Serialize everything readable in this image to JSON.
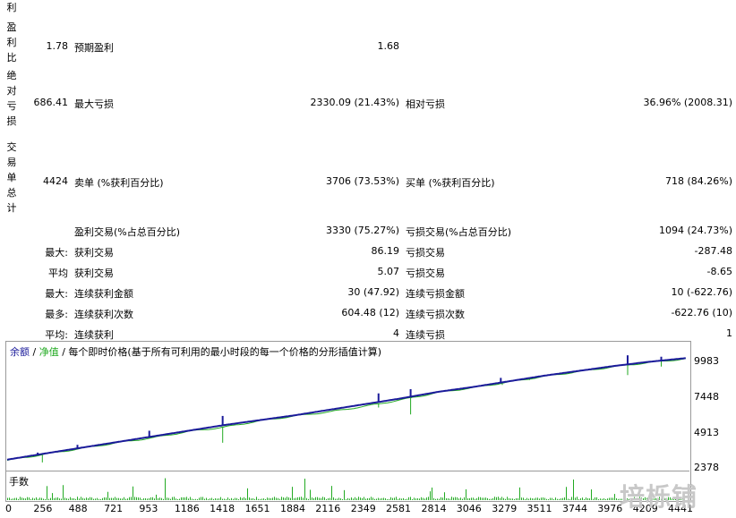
{
  "stats": {
    "left_labels": [
      {
        "text": "利",
        "top": 0
      },
      {
        "text": "盈利比",
        "top": 22
      },
      {
        "text": "绝对亏损",
        "top": 76
      },
      {
        "text": "交易单总计",
        "top": 156
      }
    ],
    "rows": [
      {
        "key": "profit_ratio",
        "c1_value": "1.78",
        "c2_label": "预期盈利",
        "c2_value": "1.68"
      },
      {
        "key": "drawdown",
        "c1_value": "686.41",
        "c2_label": "最大亏损",
        "c2_value": "2330.09 (21.43%)",
        "c3_label": "相对亏损",
        "c3_value": "36.96% (2008.31)"
      },
      {
        "key": "trades",
        "c1_value": "4424",
        "c2_label": "卖单 (%获利百分比)",
        "c2_value": "3706 (73.53%)",
        "c3_label": "买单 (%获利百分比)",
        "c3_value": "718 (84.26%)"
      },
      {
        "key": "win_loss",
        "c1_value": "",
        "c2_label": "盈利交易(%占总百分比)",
        "c2_value": "3330 (75.27%)",
        "c3_label": "亏损交易(%占总百分比)",
        "c3_value": "1094 (24.73%)"
      },
      {
        "key": "largest",
        "c1_value": "最大:",
        "c2_label": "获利交易",
        "c2_value": "86.19",
        "c3_label": "亏损交易",
        "c3_value": "-287.48"
      },
      {
        "key": "average",
        "c1_value": "平均",
        "c2_label": "获利交易",
        "c2_value": "5.07",
        "c3_label": "亏损交易",
        "c3_value": "-8.65"
      },
      {
        "key": "max_consec",
        "c1_value": "最大:",
        "c2_label": "连续获利金额",
        "c2_value": "30 (47.92)",
        "c3_label": "连续亏损金额",
        "c3_value": "10 (-622.76)"
      },
      {
        "key": "most_consec",
        "c1_value": "最多:",
        "c2_label": "连续获利次数",
        "c2_value": "604.48 (12)",
        "c3_label": "连续亏损次数",
        "c3_value": "-622.76 (10)"
      },
      {
        "key": "avg_consec",
        "c1_value": "平均:",
        "c2_label": "连续获利",
        "c2_value": "4",
        "c3_label": "连续亏损",
        "c3_value": "1"
      }
    ]
  },
  "chart": {
    "legend_balance": "余额",
    "legend_sep": "/",
    "legend_equity": "净值",
    "legend_desc": "/ 每个即时价格(基于所有可利用的最小时段的每一个价格的分形插值计算)",
    "lots_label": "手数",
    "balance_color": "#1a1a9a",
    "equity_color": "#22aa22",
    "lots_color": "#22aa22"
  },
  "chart_data": {
    "type": "line",
    "series": [
      {
        "name": "余额",
        "x": [
          0,
          256,
          488,
          721,
          953,
          1186,
          1418,
          1651,
          1884,
          2116,
          2349,
          2581,
          2814,
          3046,
          3279,
          3511,
          3744,
          3976,
          4209,
          4441
        ],
        "values": [
          2900,
          3350,
          3750,
          4150,
          4550,
          4950,
          5350,
          5700,
          6050,
          6450,
          6850,
          7250,
          7700,
          8050,
          8450,
          8850,
          9200,
          9550,
          9850,
          10100
        ]
      },
      {
        "name": "净值",
        "x": [
          0,
          256,
          488,
          721,
          953,
          1186,
          1418,
          1651,
          1884,
          2116,
          2349,
          2581,
          2814,
          3046,
          3279,
          3511,
          3744,
          3976,
          4209,
          4441
        ],
        "values": [
          2850,
          3300,
          3700,
          4100,
          4450,
          4900,
          5200,
          5650,
          6000,
          6300,
          6700,
          7150,
          7650,
          8000,
          8400,
          8800,
          9150,
          9500,
          9800,
          10050
        ]
      }
    ],
    "y_ticks": [
      "9983",
      "7448",
      "4913",
      "2378"
    ],
    "x_ticks": [
      "0",
      "256",
      "488",
      "721",
      "953",
      "1186",
      "1418",
      "1651",
      "1884",
      "2116",
      "2349",
      "2581",
      "2814",
      "3046",
      "3279",
      "3511",
      "3744",
      "3976",
      "4209",
      "4441"
    ],
    "ylim": [
      2378,
      10500
    ],
    "xlim": [
      0,
      4441
    ],
    "spikes": [
      {
        "x": 230,
        "low": 2700
      },
      {
        "x": 930,
        "low": 4700
      },
      {
        "x": 1410,
        "low": 4100
      },
      {
        "x": 2430,
        "low": 6600
      },
      {
        "x": 2640,
        "low": 6100
      },
      {
        "x": 3240,
        "low": 8200
      },
      {
        "x": 3420,
        "low": 8550
      },
      {
        "x": 4060,
        "low": 8900
      },
      {
        "x": 4280,
        "low": 9500
      }
    ],
    "bumps": [
      {
        "x": 200,
        "high": 3400
      },
      {
        "x": 460,
        "high": 3950
      },
      {
        "x": 930,
        "high": 4950
      },
      {
        "x": 1410,
        "high": 6000
      },
      {
        "x": 2430,
        "high": 7600
      },
      {
        "x": 2640,
        "high": 7900
      },
      {
        "x": 3230,
        "high": 8700
      },
      {
        "x": 4060,
        "high": 10300
      },
      {
        "x": 4280,
        "high": 10200
      }
    ]
  },
  "watermark": "培栎铺"
}
